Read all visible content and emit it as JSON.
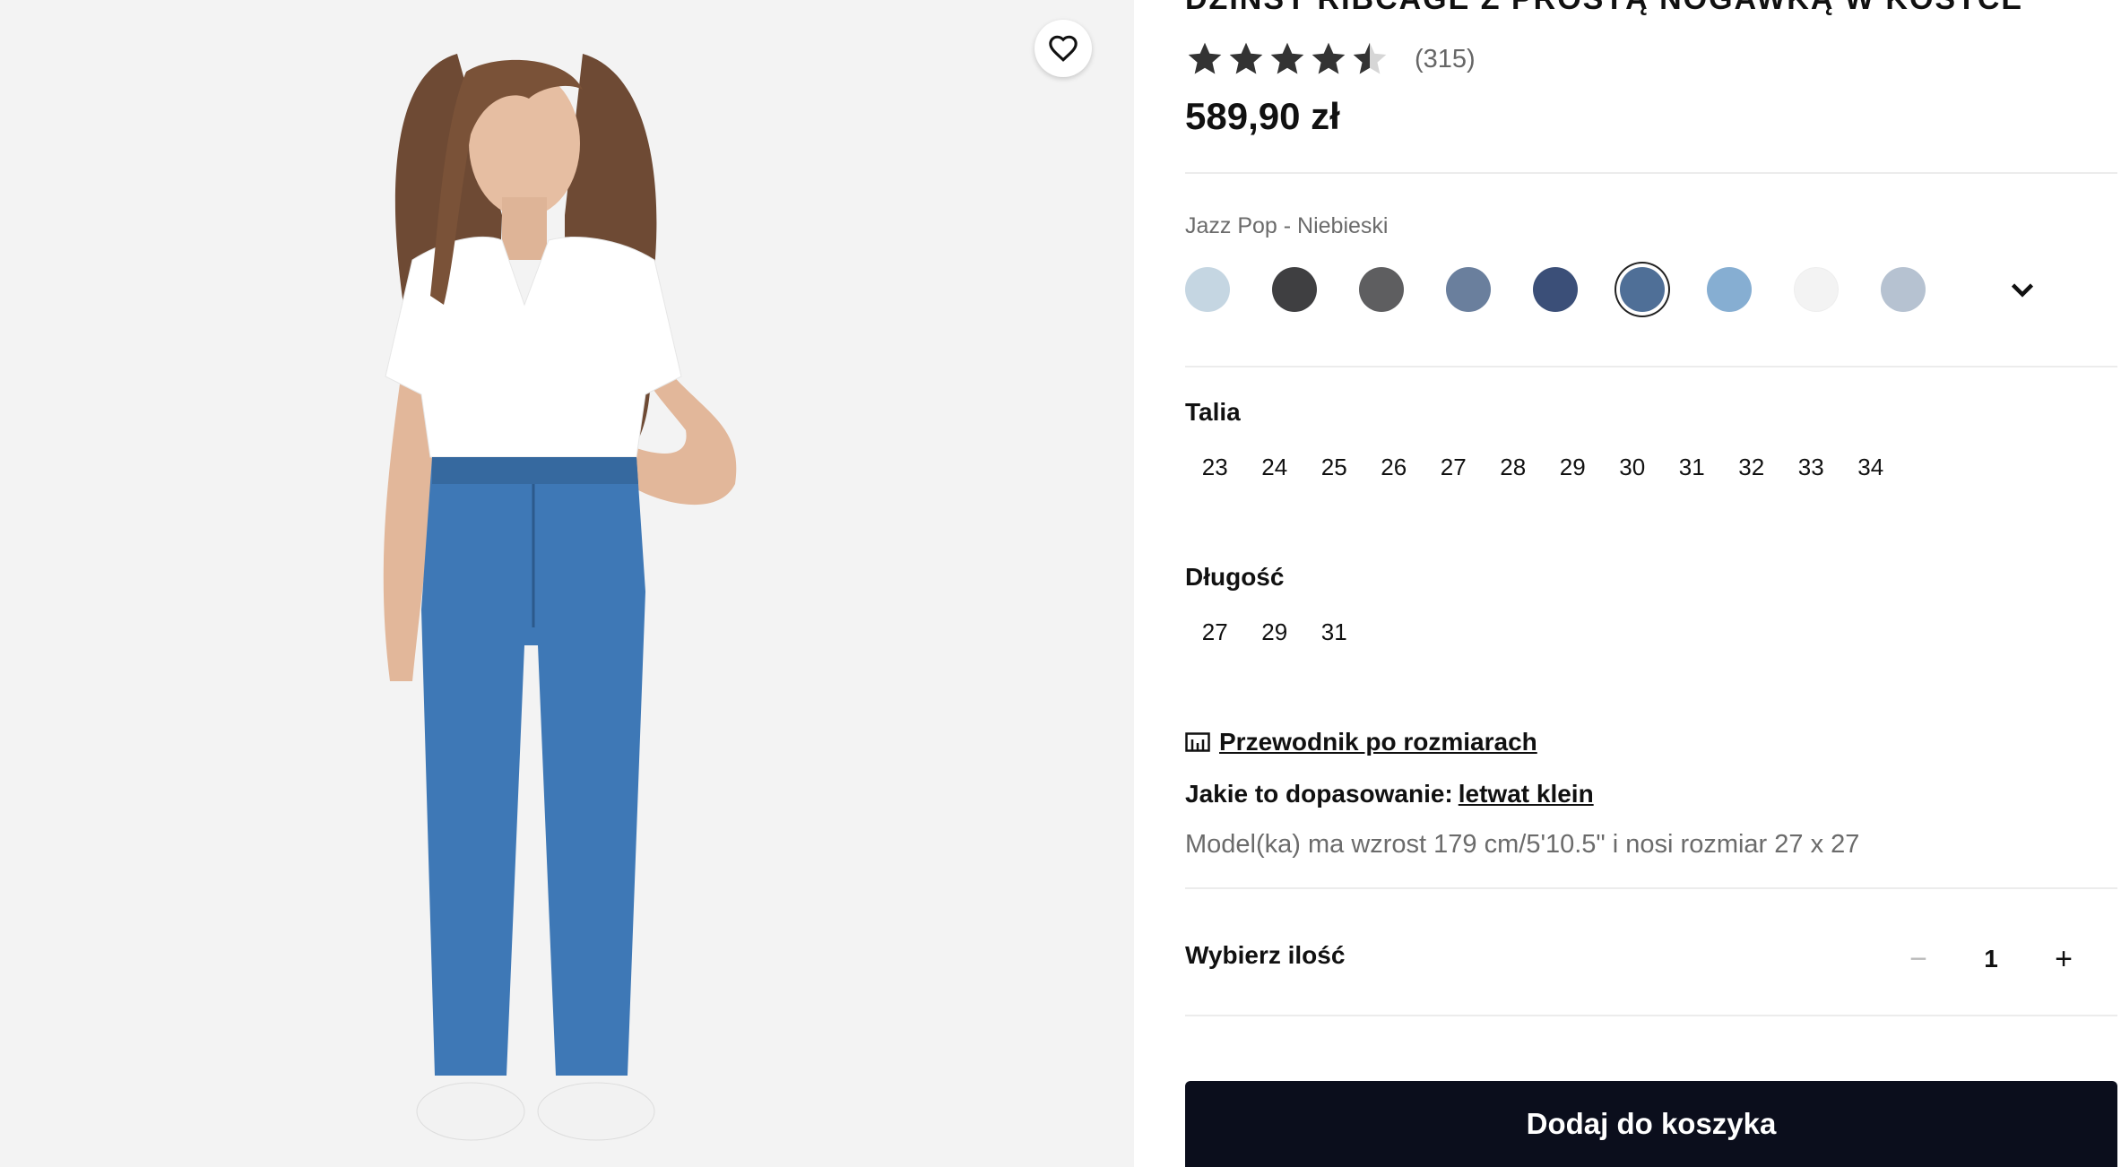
{
  "product": {
    "title": "DŻINSY RIBCAGE Z PROSTĄ NOGAWKĄ W KOSTCE",
    "rating": 4.5,
    "review_count": "(315)",
    "price": "589,90 zł",
    "color_name": "Jazz Pop - Niebieski"
  },
  "swatches": [
    {
      "color": "#c5d6e2",
      "selected": false
    },
    {
      "color": "#3f3f41",
      "selected": false
    },
    {
      "color": "#5e5e60",
      "selected": false
    },
    {
      "color": "#6a7f9d",
      "selected": false
    },
    {
      "color": "#3b4f78",
      "selected": false
    },
    {
      "color": "#4f6f97",
      "selected": true
    },
    {
      "color": "#86aed2",
      "selected": false
    },
    {
      "color": "#f3f3f3",
      "selected": false
    },
    {
      "color": "#b6c2d1",
      "selected": false
    }
  ],
  "waist": {
    "label": "Talia",
    "sizes": [
      "23",
      "24",
      "25",
      "26",
      "27",
      "28",
      "29",
      "30",
      "31",
      "32",
      "33",
      "34"
    ]
  },
  "length": {
    "label": "Długość",
    "sizes": [
      "27",
      "29",
      "31"
    ]
  },
  "size_guide": {
    "label": "Przewodnik po rozmiarach",
    "icon": "ruler-icon"
  },
  "fit": {
    "label": "Jakie to dopasowanie:",
    "link": "letwat klein"
  },
  "model_info": "Model(ka) ma wzrost 179 cm/5'10.5\" i nosi rozmiar 27 x 27",
  "quantity": {
    "label": "Wybierz ilość",
    "value": "1",
    "minus": "−",
    "plus": "+"
  },
  "cart_button": "Dodaj do koszyka",
  "colors": {
    "button_bg": "#0b0e1c",
    "image_bg": "#f3f3f3"
  }
}
